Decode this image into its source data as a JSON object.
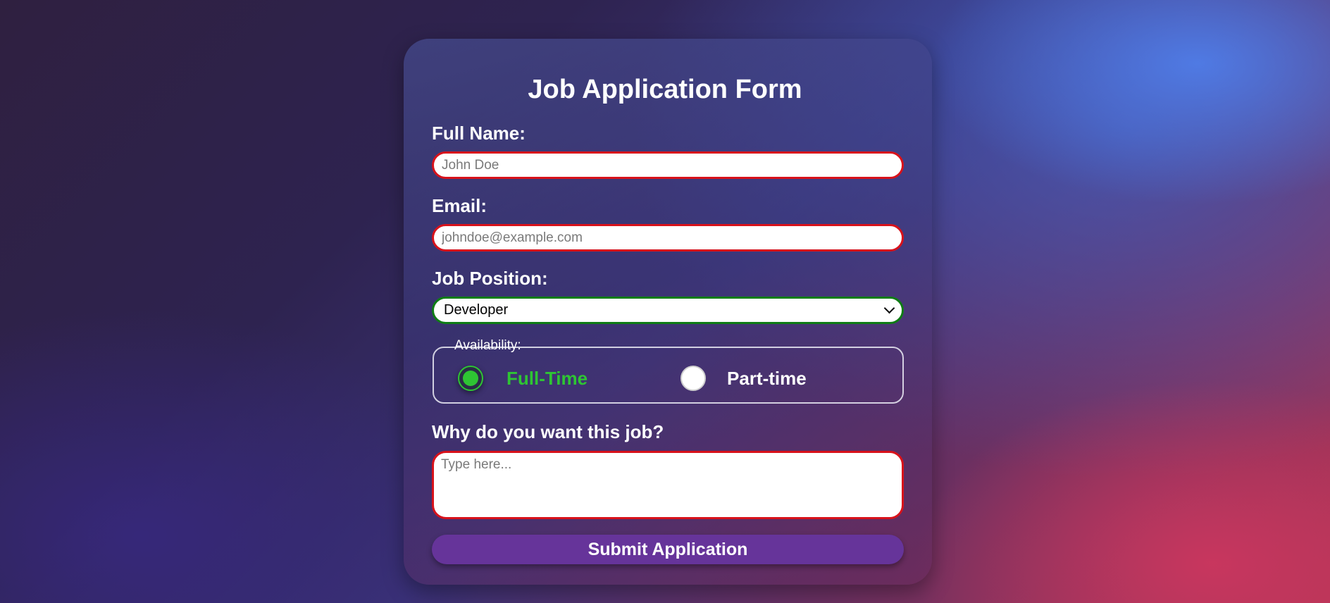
{
  "form": {
    "title": "Job Application Form",
    "full_name": {
      "label": "Full Name:",
      "placeholder": "John Doe",
      "value": ""
    },
    "email": {
      "label": "Email:",
      "placeholder": "johndoe@example.com",
      "value": ""
    },
    "job_position": {
      "label": "Job Position:",
      "selected": "Developer"
    },
    "availability": {
      "legend": "Availability:",
      "options": [
        {
          "label": "Full-Time",
          "checked": true
        },
        {
          "label": "Part-time",
          "checked": false
        }
      ]
    },
    "why": {
      "label": "Why do you want this job?",
      "placeholder": "Type here..."
    },
    "submit_label": "Submit Application"
  },
  "colors": {
    "invalid_border": "#d8121b",
    "valid_border": "#0f7d15",
    "checked_accent": "#2ec533",
    "submit_bg": "#66349a"
  },
  "icons": {
    "select_arrow": "chevron-down-icon"
  }
}
